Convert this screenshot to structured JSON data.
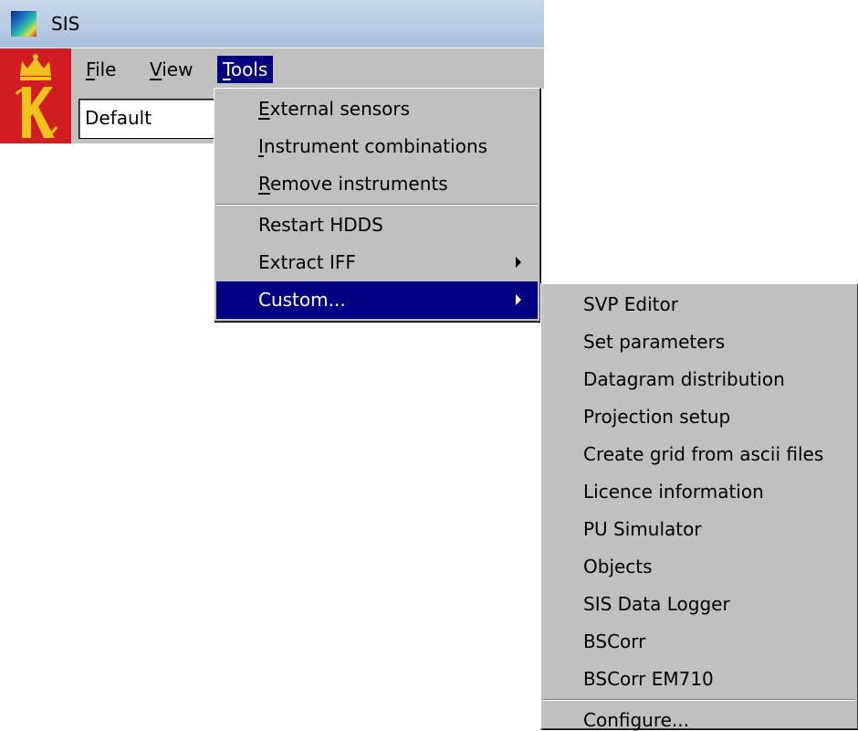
{
  "window": {
    "title": "SIS"
  },
  "menubar": {
    "file": {
      "u": "F",
      "rest": "ile"
    },
    "view": {
      "u": "V",
      "rest": "iew"
    },
    "tools": {
      "u": "T",
      "rest": "ools"
    }
  },
  "toolbar": {
    "profile_value": "Default"
  },
  "tools_menu": {
    "items": [
      {
        "u": "E",
        "rest": "xternal sensors"
      },
      {
        "u": "I",
        "rest": "nstrument combinations"
      },
      {
        "u": "R",
        "rest": "emove instruments"
      },
      {
        "label": "Restart HDDS"
      },
      {
        "label": "Extract IFF"
      },
      {
        "label": "Custom..."
      }
    ]
  },
  "custom_menu": {
    "items": [
      "SVP Editor",
      "Set parameters",
      "Datagram distribution",
      "Projection setup",
      "Create grid from ascii files",
      "Licence information",
      "PU Simulator",
      "Objects",
      "SIS Data Logger",
      "BSCorr",
      "BSCorr EM710",
      "Configure..."
    ]
  },
  "colors": {
    "menu_bg": "#c0c0c0",
    "highlight": "#000080",
    "logo_red": "#d21c24",
    "logo_gold": "#f2c21a"
  },
  "icons": {
    "app": "sis-app-icon",
    "logo": "kongsberg-crest-logo",
    "submenu": "submenu-arrow-icon"
  }
}
